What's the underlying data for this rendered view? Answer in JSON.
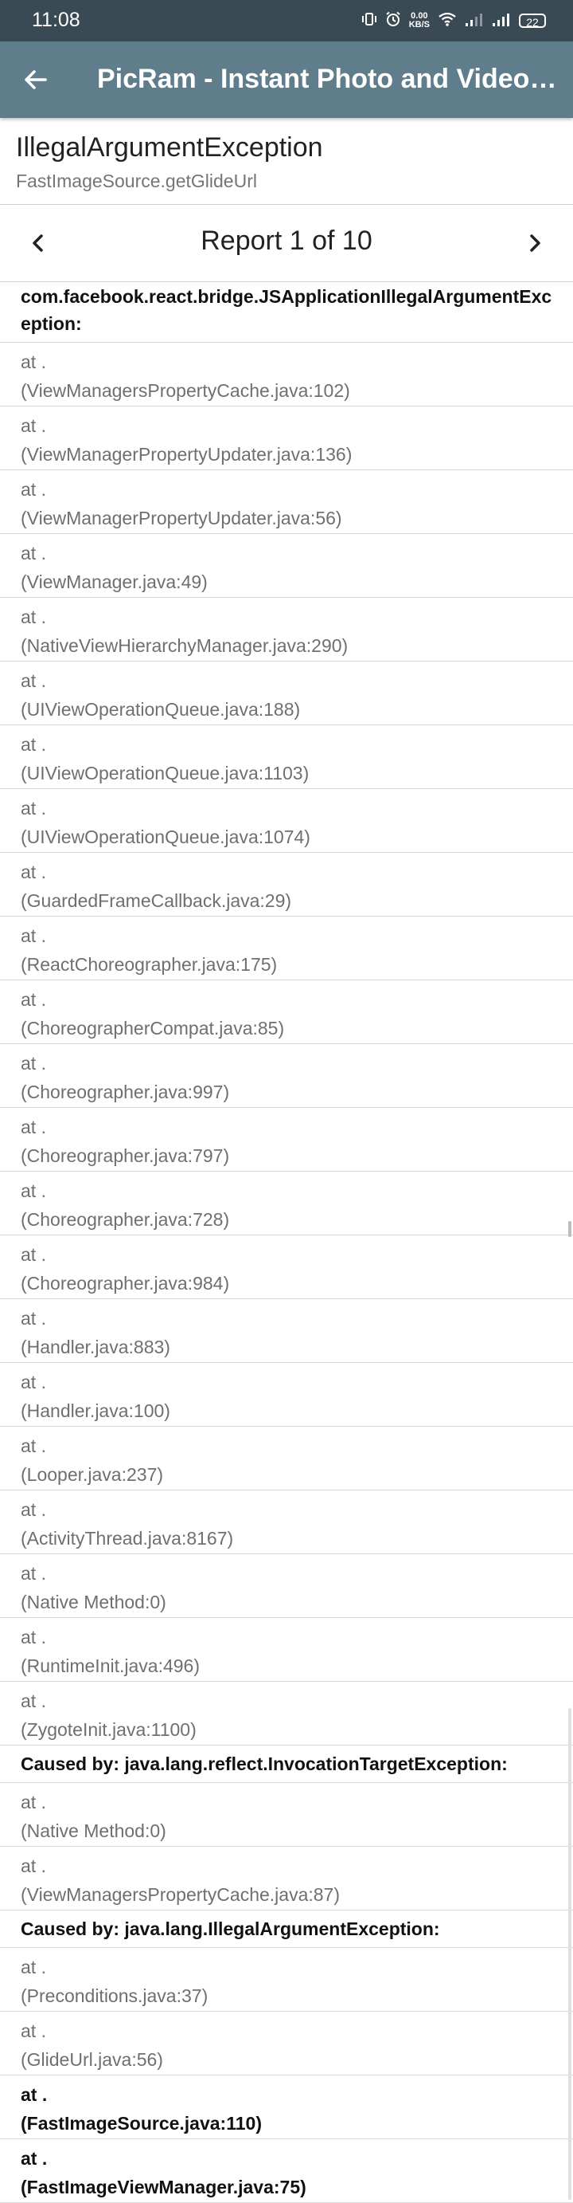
{
  "status": {
    "time": "11:08",
    "net_speed_value": "0.00",
    "net_speed_unit": "KB/S",
    "battery": "22"
  },
  "toolbar": {
    "back_icon": "arrow-left-icon",
    "title": "PicRam - Instant Photo and Video Sh..."
  },
  "exception": {
    "name": "IllegalArgumentException",
    "source": "FastImageSource.getGlideUrl"
  },
  "pager": {
    "label": "Report 1 of 10",
    "prev_icon": "chevron-left-icon",
    "next_icon": "chevron-right-icon"
  },
  "trace": [
    {
      "type": "head",
      "line1": "com.facebook.react.bridge.JSApplicationIllegalArgumentExc",
      "line2": "eption:"
    },
    {
      "type": "frame",
      "line1": "at .",
      "line2": "(ViewManagersPropertyCache.java:102)"
    },
    {
      "type": "frame",
      "line1": "at .",
      "line2": "(ViewManagerPropertyUpdater.java:136)"
    },
    {
      "type": "frame",
      "line1": "at .",
      "line2": "(ViewManagerPropertyUpdater.java:56)"
    },
    {
      "type": "frame",
      "line1": "at .",
      "line2": "(ViewManager.java:49)"
    },
    {
      "type": "frame",
      "line1": "at .",
      "line2": "(NativeViewHierarchyManager.java:290)"
    },
    {
      "type": "frame",
      "line1": "at .",
      "line2": "(UIViewOperationQueue.java:188)"
    },
    {
      "type": "frame",
      "line1": "at .",
      "line2": "(UIViewOperationQueue.java:1103)"
    },
    {
      "type": "frame",
      "line1": "at .",
      "line2": "(UIViewOperationQueue.java:1074)"
    },
    {
      "type": "frame",
      "line1": "at .",
      "line2": "(GuardedFrameCallback.java:29)"
    },
    {
      "type": "frame",
      "line1": "at .",
      "line2": "(ReactChoreographer.java:175)"
    },
    {
      "type": "frame",
      "line1": "at .",
      "line2": "(ChoreographerCompat.java:85)"
    },
    {
      "type": "frame",
      "line1": "at .",
      "line2": "(Choreographer.java:997)"
    },
    {
      "type": "frame",
      "line1": "at .",
      "line2": "(Choreographer.java:797)"
    },
    {
      "type": "frame",
      "line1": "at .",
      "line2": "(Choreographer.java:728)"
    },
    {
      "type": "frame",
      "line1": "at .",
      "line2": "(Choreographer.java:984)"
    },
    {
      "type": "frame",
      "line1": "at .",
      "line2": "(Handler.java:883)"
    },
    {
      "type": "frame",
      "line1": "at .",
      "line2": "(Handler.java:100)"
    },
    {
      "type": "frame",
      "line1": "at .",
      "line2": "(Looper.java:237)"
    },
    {
      "type": "frame",
      "line1": "at .",
      "line2": "(ActivityThread.java:8167)"
    },
    {
      "type": "frame",
      "line1": "at .",
      "line2": "(Native Method:0)"
    },
    {
      "type": "frame",
      "line1": "at .",
      "line2": "(RuntimeInit.java:496)"
    },
    {
      "type": "frame",
      "line1": "at .",
      "line2": "(ZygoteInit.java:1100)"
    },
    {
      "type": "cause",
      "line1": "Caused by: java.lang.reflect.InvocationTargetException:"
    },
    {
      "type": "frame",
      "line1": "at .",
      "line2": "(Native Method:0)"
    },
    {
      "type": "frame",
      "line1": "at .",
      "line2": "(ViewManagersPropertyCache.java:87)"
    },
    {
      "type": "cause",
      "line1": "Caused by: java.lang.IllegalArgumentException:"
    },
    {
      "type": "frame",
      "line1": "at .",
      "line2": "(Preconditions.java:37)"
    },
    {
      "type": "frame",
      "line1": "at .",
      "line2": "(GlideUrl.java:56)"
    },
    {
      "type": "frame-bold",
      "line1": "at .",
      "line2": "(FastImageSource.java:110)"
    },
    {
      "type": "frame-bold",
      "line1": "at .",
      "line2": "(FastImageViewManager.java:75)"
    }
  ]
}
